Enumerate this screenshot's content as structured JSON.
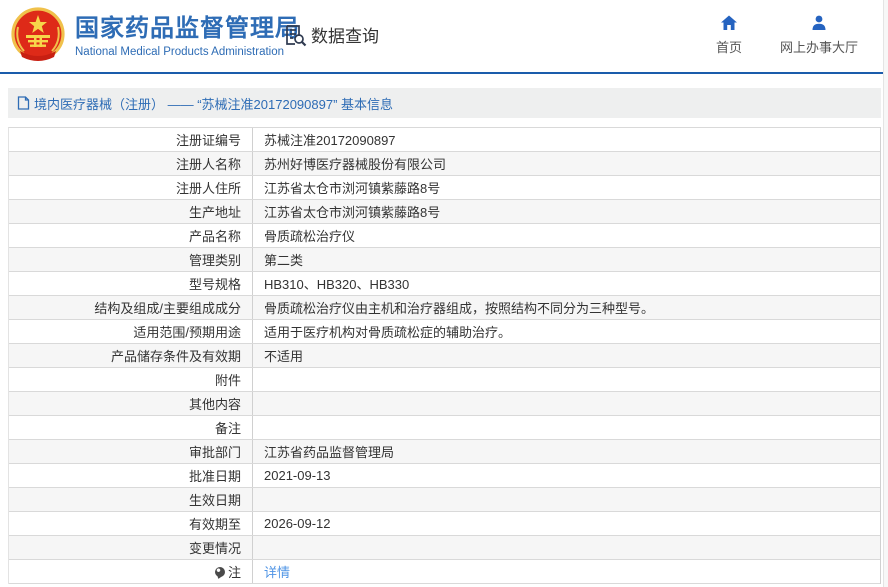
{
  "header": {
    "logo": {
      "title": "国家药品监督管理局",
      "subtitle": "National Medical Products Administration"
    },
    "section": {
      "label": "数据查询",
      "icon": "document-search-icon"
    },
    "nav": [
      {
        "label": "首页",
        "icon": "home-icon"
      },
      {
        "label": "网上办事大厅",
        "icon": "person-icon"
      }
    ]
  },
  "breadcrumb": {
    "icon": "page-icon",
    "text": "境内医疗器械（注册） —— “苏械注准20172090897” 基本信息"
  },
  "table": {
    "rows": [
      {
        "label": "注册证编号",
        "value": "苏械注准20172090897"
      },
      {
        "label": "注册人名称",
        "value": "苏州好博医疗器械股份有限公司"
      },
      {
        "label": "注册人住所",
        "value": "江苏省太仓市浏河镇紫藤路8号"
      },
      {
        "label": "生产地址",
        "value": "江苏省太仓市浏河镇紫藤路8号"
      },
      {
        "label": "产品名称",
        "value": "骨质疏松治疗仪"
      },
      {
        "label": "管理类别",
        "value": "第二类"
      },
      {
        "label": "型号规格",
        "value": "HB310、HB320、HB330"
      },
      {
        "label": "结构及组成/主要组成成分",
        "value": "骨质疏松治疗仪由主机和治疗器组成，按照结构不同分为三种型号。"
      },
      {
        "label": "适用范围/预期用途",
        "value": "适用于医疗机构对骨质疏松症的辅助治疗。"
      },
      {
        "label": "产品储存条件及有效期",
        "value": "不适用"
      },
      {
        "label": "附件",
        "value": ""
      },
      {
        "label": "其他内容",
        "value": ""
      },
      {
        "label": "备注",
        "value": ""
      },
      {
        "label": "审批部门",
        "value": "江苏省药品监督管理局"
      },
      {
        "label": "批准日期",
        "value": "2021-09-13"
      },
      {
        "label": "生效日期",
        "value": ""
      },
      {
        "label": "有效期至",
        "value": "2026-09-12"
      },
      {
        "label": "变更情况",
        "value": ""
      },
      {
        "label": "注",
        "value": "详情",
        "link": true,
        "label_icon": "balloon-icon"
      }
    ]
  },
  "colors": {
    "brand_blue": "#2e6cb5",
    "rule_blue": "#1a5cab",
    "nav_icon_blue": "#2563c0",
    "link_blue": "#4f94e5",
    "breadcrumb_bg": "#eeefef",
    "row_alt_bg": "#f6f6f6",
    "border": "#d9d9d9",
    "emblem_red": "#de2a18",
    "emblem_gold": "#f0c14b",
    "icon_dark": "#2f3a50"
  }
}
